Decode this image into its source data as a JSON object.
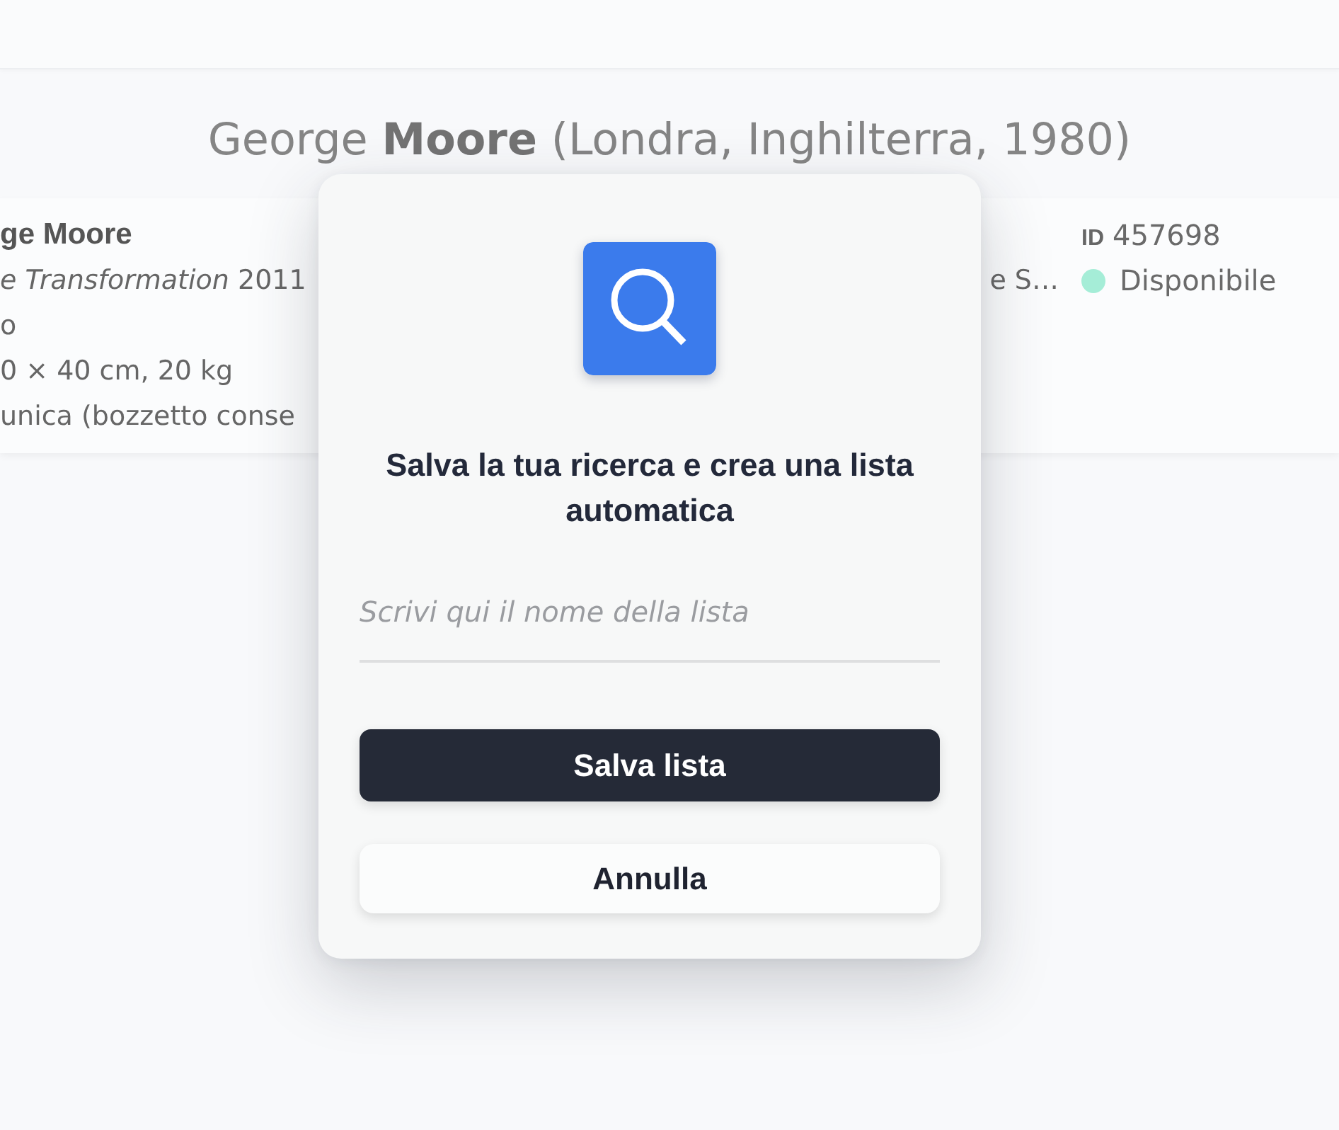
{
  "heading": "George **Moore** (Londra, Inghilterra, 1980)",
  "card": {
    "column_1": [
      {
        "kind": "name",
        "text": "ge Moore"
      },
      {
        "kind": "text",
        "text": "*e Transformation* 2011"
      },
      {
        "kind": "text",
        "text": "o"
      },
      {
        "kind": "text",
        "text": "0 × 40 cm, 20 kg"
      },
      {
        "kind": "text",
        "text": "unica (bozzetto conse"
      }
    ],
    "column_2": [
      {
        "kind": "gap"
      },
      {
        "kind": "text",
        "text": "e S…"
      }
    ],
    "column_3": {
      "id_label": "ID",
      "id_value": "457698",
      "status": {
        "label": "Disponibile",
        "color": "#a5edd7"
      }
    }
  },
  "dialog": {
    "title": "Salva la tua ricerca e crea una lista automatica",
    "input": {
      "placeholder": "Scrivi qui il nome della lista"
    },
    "buttons": [
      {
        "kind": "primary",
        "label": "Salva lista"
      },
      {
        "kind": "secondary",
        "label": "Annulla"
      }
    ]
  }
}
